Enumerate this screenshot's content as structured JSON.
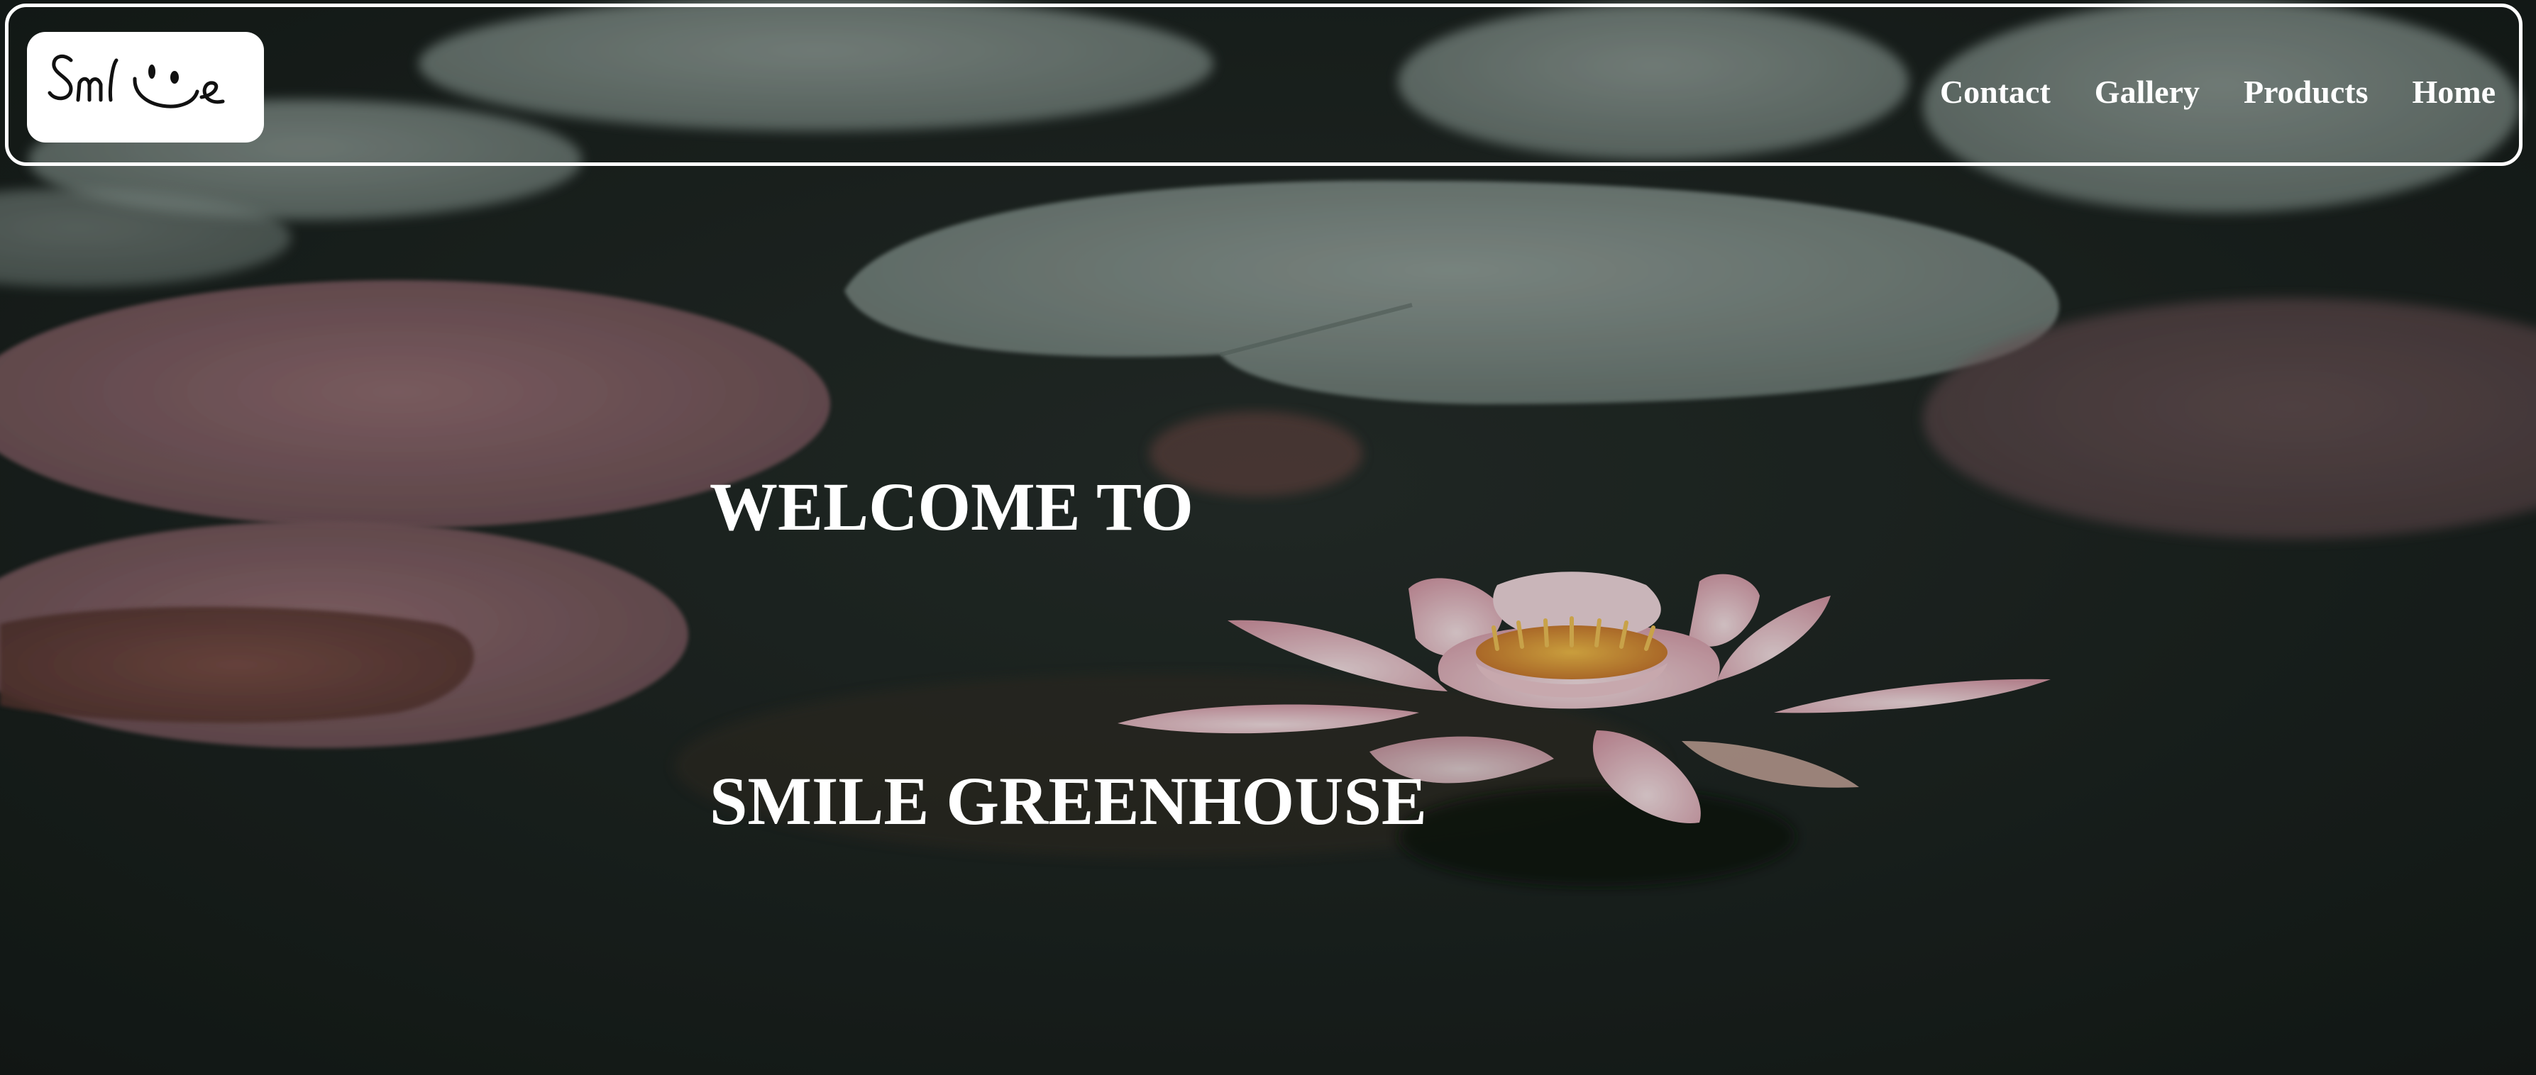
{
  "brand": {
    "logo_text": "Smile",
    "logo_icon": "smiley-face-icon"
  },
  "nav": {
    "items": [
      {
        "label": "Contact"
      },
      {
        "label": "Gallery"
      },
      {
        "label": "Products"
      },
      {
        "label": "Home"
      }
    ]
  },
  "hero": {
    "line1": "WELCOME TO",
    "line2": "SMILE GREENHOUSE",
    "background": "lotus-pond-photo"
  },
  "colors": {
    "water": "#1b2421",
    "lily_pad": "#8f9e98",
    "lily_pad_pink": "#8a6468",
    "lotus_petal": "#f2d3d9",
    "lotus_center": "#e8a23a",
    "text": "#ffffff"
  }
}
